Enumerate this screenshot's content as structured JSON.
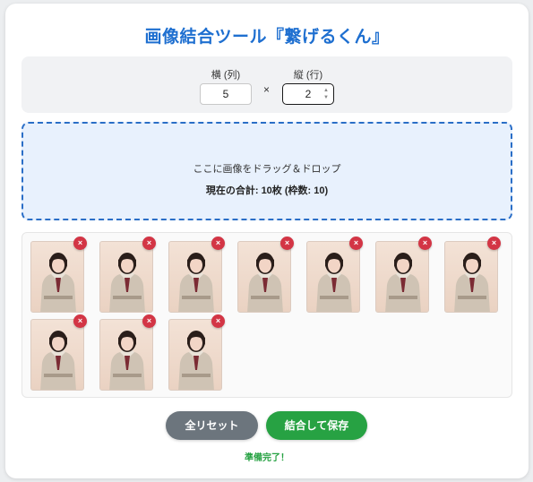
{
  "app": {
    "title": "画像結合ツール『繋げるくん』"
  },
  "settings": {
    "cols_label": "横 (列)",
    "cols_value": "5",
    "times_symbol": "×",
    "rows_label": "縦 (行)",
    "rows_value": "2"
  },
  "dropzone": {
    "prompt": "ここに画像をドラッグ＆ドロップ",
    "total": "現在の合計: 10枚 (枠数: 10)"
  },
  "gallery": {
    "remove_symbol": "×",
    "image_count": 10
  },
  "actions": {
    "reset_label": "全リセット",
    "save_label": "結合して保存"
  },
  "status": {
    "message": "準備完了！"
  },
  "colors": {
    "title": "#1e6fd0",
    "dropzone_border": "#2a6ec7",
    "remove": "#d33545",
    "reset": "#6c757d",
    "save": "#27a243",
    "status": "#27a243"
  }
}
